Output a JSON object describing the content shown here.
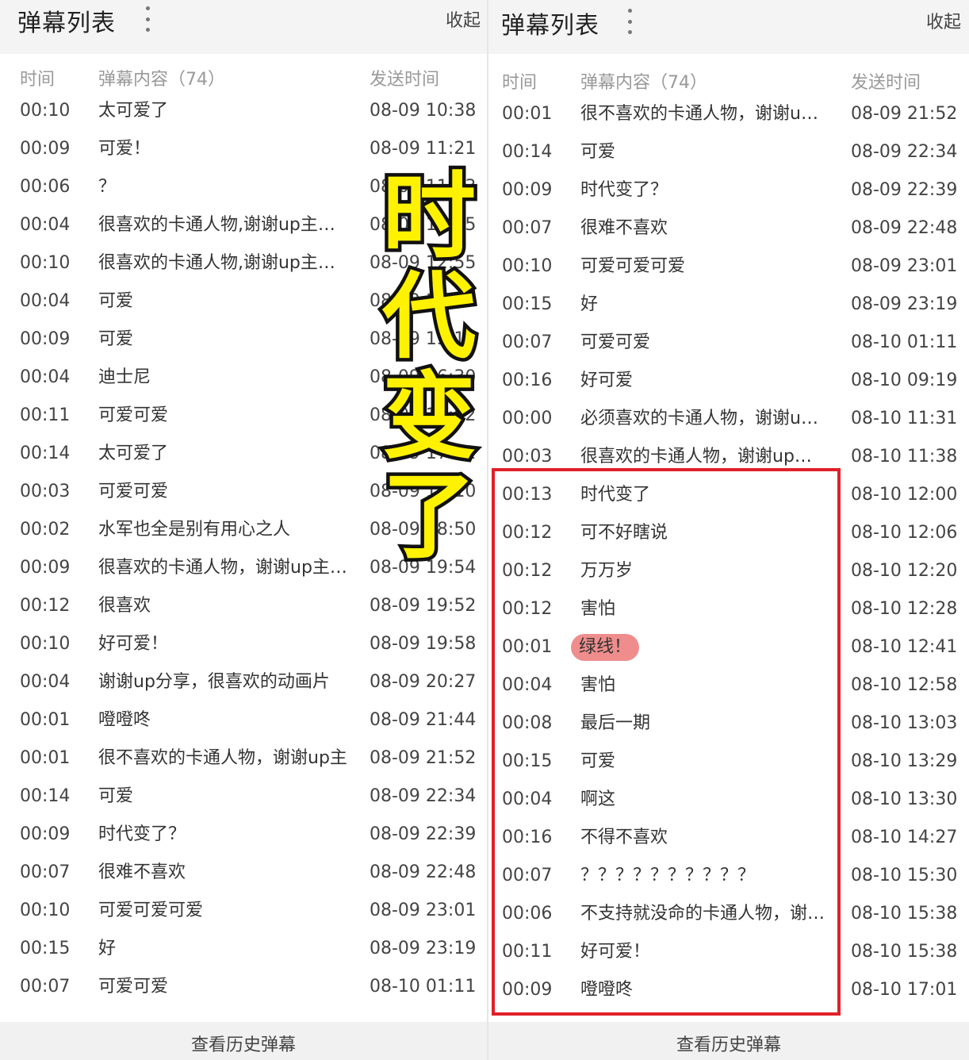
{
  "left_panel": {
    "title": "弹幕列表",
    "collapse_label": "收起",
    "columns": {
      "time": "时间",
      "content": "弹幕内容（74）",
      "sent": "发送时间"
    },
    "rows": [
      {
        "time": "00:10",
        "content": "太可爱了",
        "sent": "08-09 10:38"
      },
      {
        "time": "00:09",
        "content": "可爱！",
        "sent": "08-09 11:21"
      },
      {
        "time": "00:06",
        "content": "？",
        "sent": "08-09 11:23"
      },
      {
        "time": "00:04",
        "content": "很喜欢的卡通人物,谢谢up主分享",
        "sent": "08-09 12:05"
      },
      {
        "time": "00:10",
        "content": "很喜欢的卡通人物,谢谢up主分享",
        "sent": "08-09 12:55"
      },
      {
        "time": "00:04",
        "content": "可爱",
        "sent": "08-09 14:02"
      },
      {
        "time": "00:09",
        "content": "可爱",
        "sent": "08-09 15:10"
      },
      {
        "time": "00:04",
        "content": "迪士尼",
        "sent": "08-09 16:30"
      },
      {
        "time": "00:11",
        "content": "可爱可爱",
        "sent": "08-09 17:02"
      },
      {
        "time": "00:14",
        "content": "太可爱了",
        "sent": "08-09 17:32"
      },
      {
        "time": "00:03",
        "content": "可爱可爱",
        "sent": "08-09 18:10"
      },
      {
        "time": "00:02",
        "content": "水军也全是别有用心之人",
        "sent": "08-09 18:50"
      },
      {
        "time": "00:09",
        "content": "很喜欢的卡通人物，谢谢up主分享",
        "sent": "08-09 19:54"
      },
      {
        "time": "00:12",
        "content": "很喜欢",
        "sent": "08-09 19:52"
      },
      {
        "time": "00:10",
        "content": "好可爱！",
        "sent": "08-09 19:58"
      },
      {
        "time": "00:04",
        "content": "谢谢up分享，很喜欢的动画片",
        "sent": "08-09 20:27"
      },
      {
        "time": "00:01",
        "content": "噔噔咚",
        "sent": "08-09 21:44"
      },
      {
        "time": "00:01",
        "content": "很不喜欢的卡通人物，谢谢up主",
        "sent": "08-09 21:52"
      },
      {
        "time": "00:14",
        "content": "可爱",
        "sent": "08-09 22:34"
      },
      {
        "time": "00:09",
        "content": "时代变了？",
        "sent": "08-09 22:39"
      },
      {
        "time": "00:07",
        "content": "很难不喜欢",
        "sent": "08-09 22:48"
      },
      {
        "time": "00:10",
        "content": "可爱可爱可爱",
        "sent": "08-09 23:01"
      },
      {
        "time": "00:15",
        "content": "好",
        "sent": "08-09 23:19"
      },
      {
        "time": "00:07",
        "content": "可爱可爱",
        "sent": "08-10 01:11"
      }
    ],
    "footer_label": "查看历史弹幕"
  },
  "right_panel": {
    "title": "弹幕列表",
    "collapse_label": "收起",
    "columns": {
      "time": "时间",
      "content": "弹幕内容（74）",
      "sent": "发送时间"
    },
    "rows": [
      {
        "time": "00:01",
        "content": "很不喜欢的卡通人物，谢谢up主",
        "sent": "08-09 21:52"
      },
      {
        "time": "00:14",
        "content": "可爱",
        "sent": "08-09 22:34"
      },
      {
        "time": "00:09",
        "content": "时代变了？",
        "sent": "08-09 22:39"
      },
      {
        "time": "00:07",
        "content": "很难不喜欢",
        "sent": "08-09 22:48"
      },
      {
        "time": "00:10",
        "content": "可爱可爱可爱",
        "sent": "08-09 23:01"
      },
      {
        "time": "00:15",
        "content": "好",
        "sent": "08-09 23:19"
      },
      {
        "time": "00:07",
        "content": "可爱可爱",
        "sent": "08-10 01:11"
      },
      {
        "time": "00:16",
        "content": "好可爱",
        "sent": "08-10 09:19"
      },
      {
        "time": "00:00",
        "content": "必须喜欢的卡通人物，谢谢up主",
        "sent": "08-10 11:31"
      },
      {
        "time": "00:03",
        "content": "很喜欢的卡通人物，谢谢up主分享",
        "sent": "08-10 11:38"
      },
      {
        "time": "00:13",
        "content": "时代变了",
        "sent": "08-10 12:00"
      },
      {
        "time": "00:12",
        "content": "可不好瞎说",
        "sent": "08-10 12:06"
      },
      {
        "time": "00:12",
        "content": "万万岁",
        "sent": "08-10 12:20"
      },
      {
        "time": "00:12",
        "content": "害怕",
        "sent": "08-10 12:28"
      },
      {
        "time": "00:01",
        "content": "绿线！",
        "sent": "08-10 12:41",
        "highlighted": true
      },
      {
        "time": "00:04",
        "content": "害怕",
        "sent": "08-10 12:58"
      },
      {
        "time": "00:08",
        "content": "最后一期",
        "sent": "08-10 13:03"
      },
      {
        "time": "00:15",
        "content": "可爱",
        "sent": "08-10 13:29"
      },
      {
        "time": "00:04",
        "content": "啊这",
        "sent": "08-10 13:30"
      },
      {
        "time": "00:16",
        "content": "不得不喜欢",
        "sent": "08-10 14:27"
      },
      {
        "time": "00:07",
        "content": "？？？？？？？？？？",
        "sent": "08-10 15:30"
      },
      {
        "time": "00:06",
        "content": "不支持就没命的卡通人物，谢谢up主",
        "sent": "08-10 15:38"
      },
      {
        "time": "00:11",
        "content": "好可爱！",
        "sent": "08-10 15:38"
      },
      {
        "time": "00:09",
        "content": "噔噔咚",
        "sent": "08-10 17:01"
      }
    ],
    "footer_label": "查看历史弹幕"
  },
  "overlay_caption": "时代变了",
  "colors": {
    "highlight_box": "#e0202a",
    "caption_fill": "#fff200",
    "caption_stroke": "#111111",
    "badge": "#ef8d8d"
  }
}
